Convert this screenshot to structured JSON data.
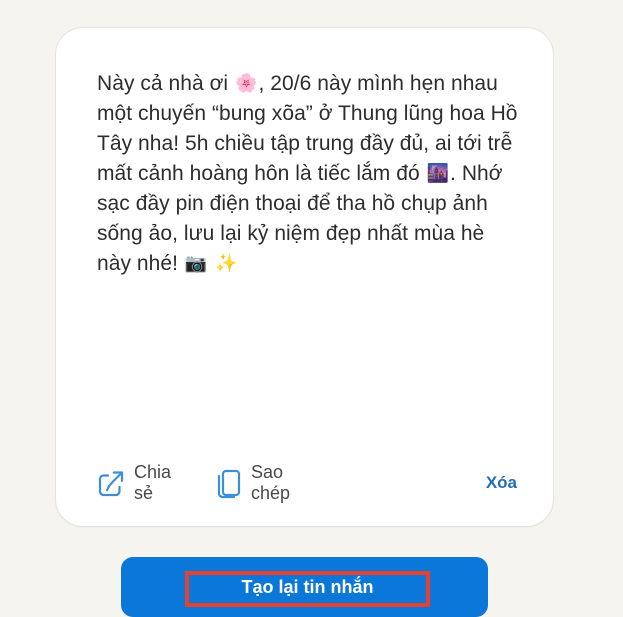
{
  "message": {
    "text_part_1": "Này cả nhà ơi ",
    "emoji_flower": "🌸",
    "text_part_2": ", 20/6 này mình hẹn nhau một chuyến “bung xõa” ở Thung lũng hoa Hồ Tây nha! 5h chiều tập trung đầy đủ, ai tới trễ mất cảnh hoàng hôn là tiếc lắm đó ",
    "emoji_sunset": "🌆",
    "text_part_3": ". Nhớ sạc đầy pin điện thoại để tha hồ chụp ảnh sống ảo, lưu lại kỷ niệm đẹp nhất mùa hè này nhé! ",
    "emoji_camera": "📷",
    "emoji_sparkles": "✨"
  },
  "actions": {
    "share": {
      "label": "Chia sẻ",
      "icon": "share-icon"
    },
    "copy": {
      "label": "Sao chép",
      "icon": "copy-icon"
    },
    "delete": {
      "label": "Xóa"
    }
  },
  "primary_action": {
    "label": "Tạo lại tin nhắn"
  },
  "colors": {
    "background": "#f6f4ef",
    "card": "#ffffff",
    "primary_button": "#0b77d8",
    "delete_text": "#1f6eb8",
    "highlight_border": "#e44130",
    "icon_blue": "#3b8fd7"
  }
}
